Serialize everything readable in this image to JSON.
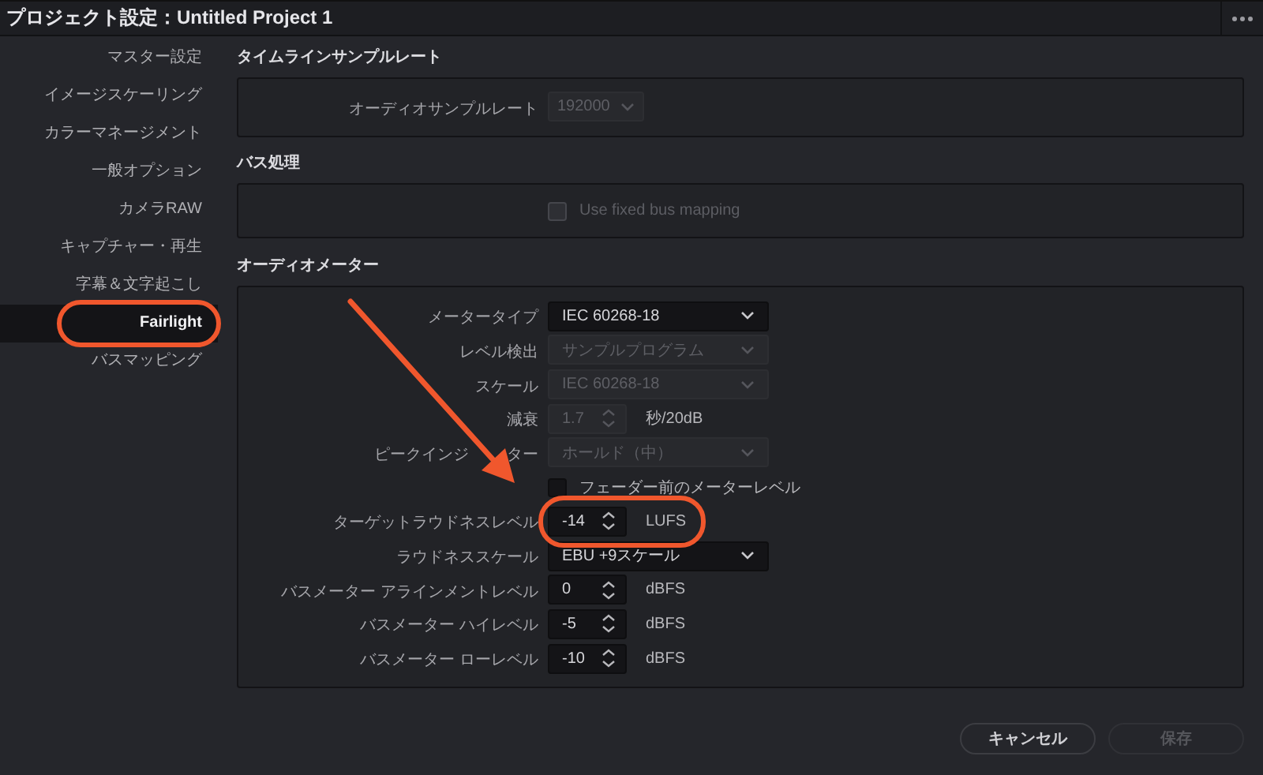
{
  "window": {
    "title": "プロジェクト設定：Untitled Project 1"
  },
  "sidebar": {
    "items": [
      {
        "label": "マスター設定",
        "selected": false,
        "highlighted": false
      },
      {
        "label": "イメージスケーリング",
        "selected": false,
        "highlighted": false
      },
      {
        "label": "カラーマネージメント",
        "selected": false,
        "highlighted": false
      },
      {
        "label": "一般オプション",
        "selected": false,
        "highlighted": false
      },
      {
        "label": "カメラRAW",
        "selected": false,
        "highlighted": false
      },
      {
        "label": "キャプチャー・再生",
        "selected": false,
        "highlighted": false
      },
      {
        "label": "字幕＆文字起こし",
        "selected": false,
        "highlighted": false
      },
      {
        "label": "Fairlight",
        "selected": true,
        "highlighted": true
      },
      {
        "label": "バスマッピング",
        "selected": false,
        "highlighted": false
      }
    ]
  },
  "sections": [
    {
      "title": "タイムラインサンプルレート",
      "rows": [
        {
          "kind": "compact-dropdown",
          "label": "オーディオサンプルレート",
          "value": "192000",
          "disabled": true
        }
      ]
    },
    {
      "title": "バス処理",
      "rows": [
        {
          "kind": "checkbox",
          "text": "Use fixed bus mapping",
          "checked": false,
          "disabled": true
        }
      ]
    },
    {
      "title": "オーディオメーター",
      "rows": [
        {
          "kind": "dropdown",
          "label": "メータータイプ",
          "value": "IEC 60268-18",
          "disabled": false
        },
        {
          "kind": "dropdown",
          "label": "レベル検出",
          "value": "サンプルプログラム",
          "disabled": true
        },
        {
          "kind": "dropdown",
          "label": "スケール",
          "value": "IEC 60268-18",
          "disabled": true
        },
        {
          "kind": "spinner",
          "label": "減衰",
          "value": "1.7",
          "unit": "秒/20dB",
          "disabled": true,
          "highlighted": false
        },
        {
          "kind": "dropdown",
          "label": "ピークインジ",
          "label_tail": "ター",
          "value": "ホールド（中）",
          "disabled": true
        },
        {
          "kind": "checkbox",
          "text": "フェーダー前のメーターレベル",
          "checked": false,
          "disabled": false
        },
        {
          "kind": "spinner",
          "label": "ターゲットラウドネスレベル",
          "value": "-14",
          "unit": "LUFS",
          "disabled": false,
          "highlighted": true
        },
        {
          "kind": "dropdown",
          "label": "ラウドネススケール",
          "value": "EBU +9スケール",
          "disabled": false
        },
        {
          "kind": "spinner",
          "label": "バスメーター アラインメントレベル",
          "value": "0",
          "unit": "dBFS",
          "disabled": false,
          "highlighted": false
        },
        {
          "kind": "spinner",
          "label": "バスメーター ハイレベル",
          "value": "-5",
          "unit": "dBFS",
          "disabled": false,
          "highlighted": false
        },
        {
          "kind": "spinner",
          "label": "バスメーター ローレベル",
          "value": "-10",
          "unit": "dBFS",
          "disabled": false,
          "highlighted": false
        }
      ]
    }
  ],
  "buttons": [
    {
      "label": "キャンセル",
      "disabled": false
    },
    {
      "label": "保存",
      "disabled": true
    }
  ],
  "annotations": {
    "arrow": true
  }
}
